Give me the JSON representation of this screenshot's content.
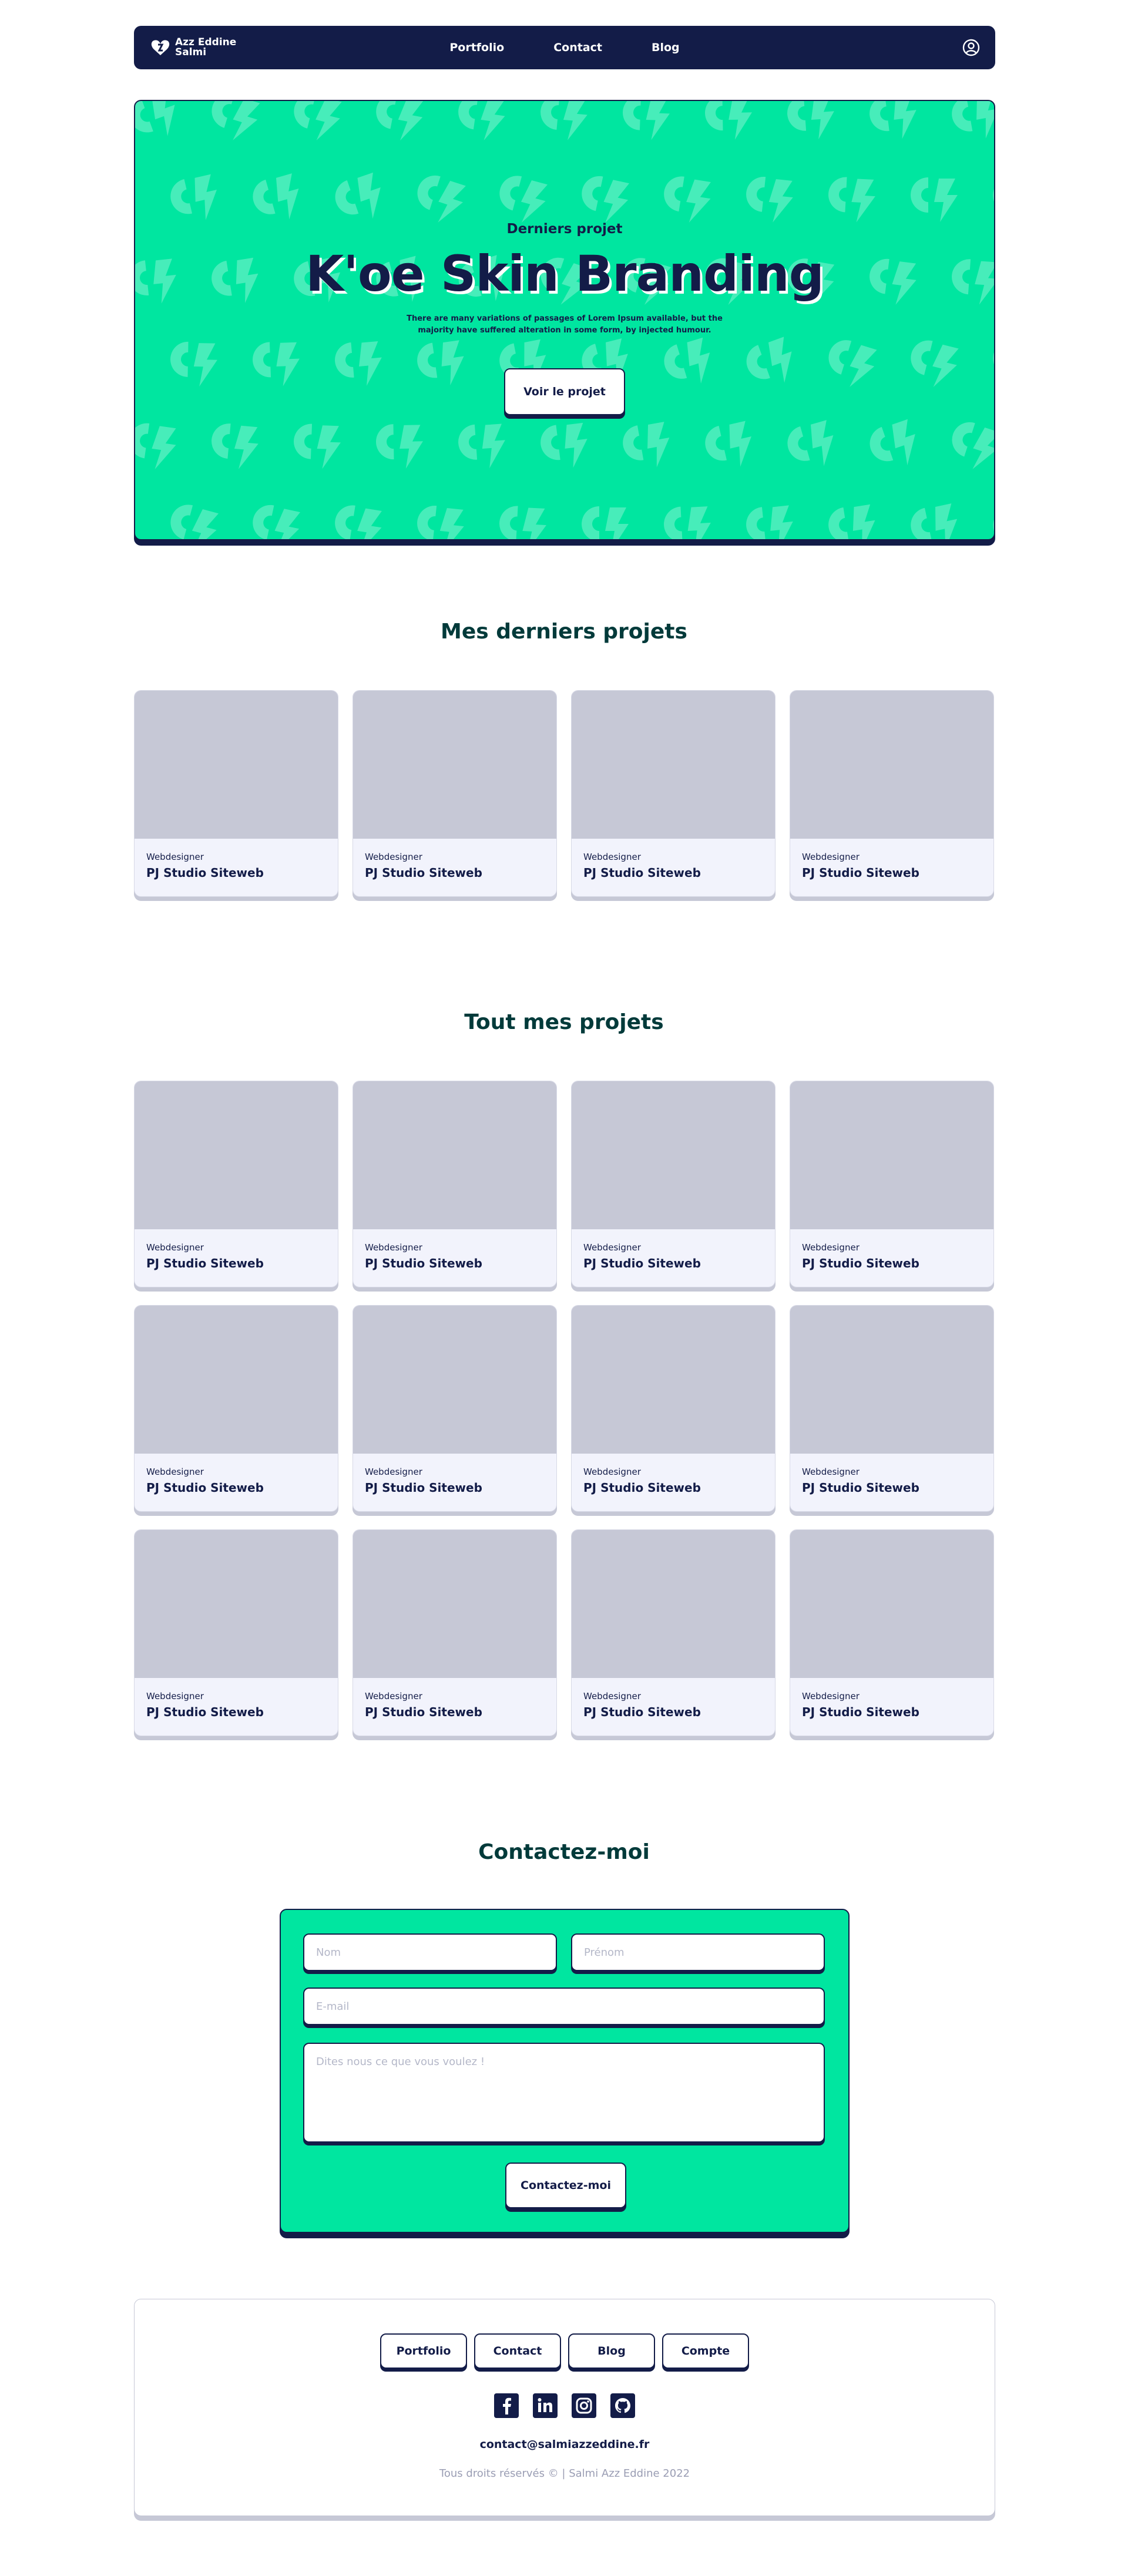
{
  "nav": {
    "logo_line1": "Azz Eddine",
    "logo_line2": "Salmi",
    "links": [
      "Portfolio",
      "Contact",
      "Blog"
    ],
    "account_icon": "user-circle-icon"
  },
  "hero": {
    "subtitle": "Derniers projet",
    "title": "K'oe Skin Branding",
    "description": "There are many variations of passages of Lorem Ipsum available, but the majority have suffered alteration in some form, by injected humour.",
    "button": "Voir le projet"
  },
  "latest": {
    "title": "Mes derniers projets",
    "cards": [
      {
        "role": "Webdesigner",
        "title": "PJ Studio Siteweb"
      },
      {
        "role": "Webdesigner",
        "title": "PJ Studio Siteweb"
      },
      {
        "role": "Webdesigner",
        "title": "PJ Studio Siteweb"
      },
      {
        "role": "Webdesigner",
        "title": "PJ Studio Siteweb"
      }
    ]
  },
  "all": {
    "title": "Tout mes projets",
    "cards": [
      {
        "role": "Webdesigner",
        "title": "PJ Studio Siteweb"
      },
      {
        "role": "Webdesigner",
        "title": "PJ Studio Siteweb"
      },
      {
        "role": "Webdesigner",
        "title": "PJ Studio Siteweb"
      },
      {
        "role": "Webdesigner",
        "title": "PJ Studio Siteweb"
      },
      {
        "role": "Webdesigner",
        "title": "PJ Studio Siteweb"
      },
      {
        "role": "Webdesigner",
        "title": "PJ Studio Siteweb"
      },
      {
        "role": "Webdesigner",
        "title": "PJ Studio Siteweb"
      },
      {
        "role": "Webdesigner",
        "title": "PJ Studio Siteweb"
      },
      {
        "role": "Webdesigner",
        "title": "PJ Studio Siteweb"
      },
      {
        "role": "Webdesigner",
        "title": "PJ Studio Siteweb"
      },
      {
        "role": "Webdesigner",
        "title": "PJ Studio Siteweb"
      },
      {
        "role": "Webdesigner",
        "title": "PJ Studio Siteweb"
      }
    ]
  },
  "contact": {
    "title": "Contactez-moi",
    "nom_placeholder": "Nom",
    "prenom_placeholder": "Prénom",
    "email_placeholder": "E-mail",
    "message_placeholder": "Dites nous ce que vous voulez !",
    "button": "Contactez-moi"
  },
  "footer": {
    "links": [
      "Portfolio",
      "Contact",
      "Blog",
      "Compte"
    ],
    "socials": [
      "facebook-icon",
      "linkedin-icon",
      "instagram-icon",
      "github-icon"
    ],
    "email": "contact@salmiazzeddine.fr",
    "copyright": "Tous droits réservés © | Salmi Azz Eddine 2022"
  },
  "colors": {
    "navy": "#131c48",
    "green": "#00e6a0",
    "card_placeholder": "#c6c8d6",
    "card_body": "#f2f3fc",
    "heading": "#003a3a"
  }
}
